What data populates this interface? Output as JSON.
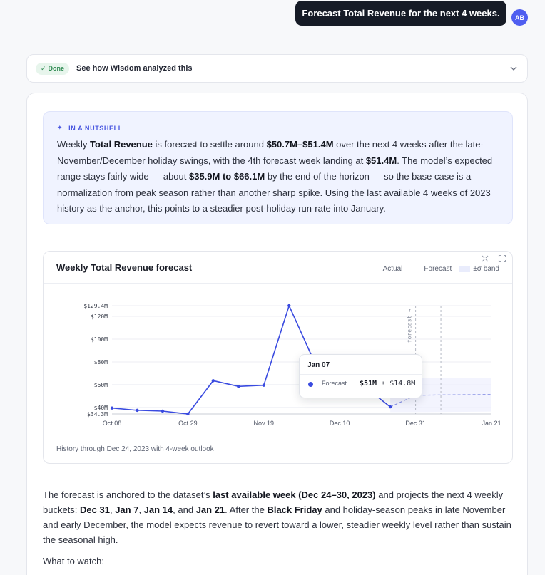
{
  "user": {
    "message": "Forecast Total Revenue for the next 4 weeks.",
    "avatar": "AB"
  },
  "analysis": {
    "status": "Done",
    "label": "See how Wisdom analyzed this"
  },
  "nutshell": {
    "heading": "IN A NUTSHELL",
    "parts": [
      {
        "t": "Weekly ",
        "b": false
      },
      {
        "t": "Total Revenue",
        "b": true
      },
      {
        "t": " is forecast to settle around ",
        "b": false
      },
      {
        "t": "$50.7M–$51.4M",
        "b": true
      },
      {
        "t": " over the next 4 weeks after the late-November/December holiday swings, with the 4th forecast week landing at ",
        "b": false
      },
      {
        "t": "$51.4M",
        "b": true
      },
      {
        "t": ". The model’s expected range stays fairly wide — about ",
        "b": false
      },
      {
        "t": "$35.9M to $66.1M",
        "b": true
      },
      {
        "t": " by the end of the horizon — so the base case is a normalization from peak season rather than another sharp spike. Using the last available 4 weeks of 2023 history as the anchor, this points to a steadier post-holiday run-rate into January.",
        "b": false
      }
    ]
  },
  "chart": {
    "title": "Weekly Total Revenue forecast",
    "legend": {
      "actual": "Actual",
      "forecast": "Forecast",
      "band": "±σ band"
    },
    "footer": "History through Dec 24, 2023 with 4-week outlook",
    "forecast_marker": "forecast →",
    "tooltip": {
      "date": "Jan 07",
      "label": "Forecast",
      "value": "$51M",
      "sigma": "± $14.8M"
    }
  },
  "chart_data": {
    "type": "line",
    "title": "Weekly Total Revenue forecast",
    "y_ticks": [
      {
        "label": "$34.3M",
        "v": 34.3
      },
      {
        "label": "$40M",
        "v": 40
      },
      {
        "label": "$60M",
        "v": 60
      },
      {
        "label": "$80M",
        "v": 80
      },
      {
        "label": "$100M",
        "v": 100
      },
      {
        "label": "$120M",
        "v": 120
      },
      {
        "label": "$129.4M",
        "v": 129.4
      }
    ],
    "ylim": [
      34.3,
      129.4
    ],
    "x_ticks": [
      {
        "label": "Oct 08",
        "w": 0
      },
      {
        "label": "Oct 29",
        "w": 3
      },
      {
        "label": "Nov 19",
        "w": 6
      },
      {
        "label": "Dec 10",
        "w": 9
      },
      {
        "label": "Dec 31",
        "w": 12
      },
      {
        "label": "Jan 21",
        "w": 15
      }
    ],
    "series": [
      {
        "name": "Actual",
        "points": [
          {
            "w": 0,
            "v": 39.5
          },
          {
            "w": 1,
            "v": 37.5
          },
          {
            "w": 2,
            "v": 36.8
          },
          {
            "w": 3,
            "v": 34.3
          },
          {
            "w": 4,
            "v": 63.5
          },
          {
            "w": 5,
            "v": 58.5
          },
          {
            "w": 6,
            "v": 59.5
          },
          {
            "w": 7,
            "v": 129.4
          },
          {
            "w": 8,
            "v": 80
          },
          {
            "w": 9,
            "v": 72
          },
          {
            "w": 10,
            "v": 58
          },
          {
            "w": 11,
            "v": 40.5
          }
        ]
      },
      {
        "name": "Forecast",
        "points": [
          {
            "w": 11,
            "v": 40.5
          },
          {
            "w": 12,
            "v": 50.7
          },
          {
            "w": 13,
            "v": 51
          },
          {
            "w": 14,
            "v": 51.2
          },
          {
            "w": 15,
            "v": 51.4
          }
        ]
      }
    ],
    "band": {
      "lower": 35.9,
      "upper": 66.1
    },
    "forecast_start_week": 12,
    "hover_week": 13
  },
  "body": {
    "parts": [
      {
        "t": "The forecast is anchored to the dataset’s ",
        "b": false
      },
      {
        "t": "last available week (Dec 24–30, 2023)",
        "b": true
      },
      {
        "t": " and projects the next 4 weekly buckets: ",
        "b": false
      },
      {
        "t": "Dec 31",
        "b": true
      },
      {
        "t": ", ",
        "b": false
      },
      {
        "t": "Jan 7",
        "b": true
      },
      {
        "t": ", ",
        "b": false
      },
      {
        "t": "Jan 14",
        "b": true
      },
      {
        "t": ", and ",
        "b": false
      },
      {
        "t": "Jan 21",
        "b": true
      },
      {
        "t": ". After the ",
        "b": false
      },
      {
        "t": "Black Friday",
        "b": true
      },
      {
        "t": " and holiday-season peaks in late November and early December, the model expects revenue to revert toward a lower, steadier weekly level rather than sustain the seasonal high.",
        "b": false
      }
    ],
    "watch": "What to watch:"
  },
  "colors": {
    "accent": "#4a57e0",
    "dark": "#161b26",
    "done": "#2f8a52"
  }
}
